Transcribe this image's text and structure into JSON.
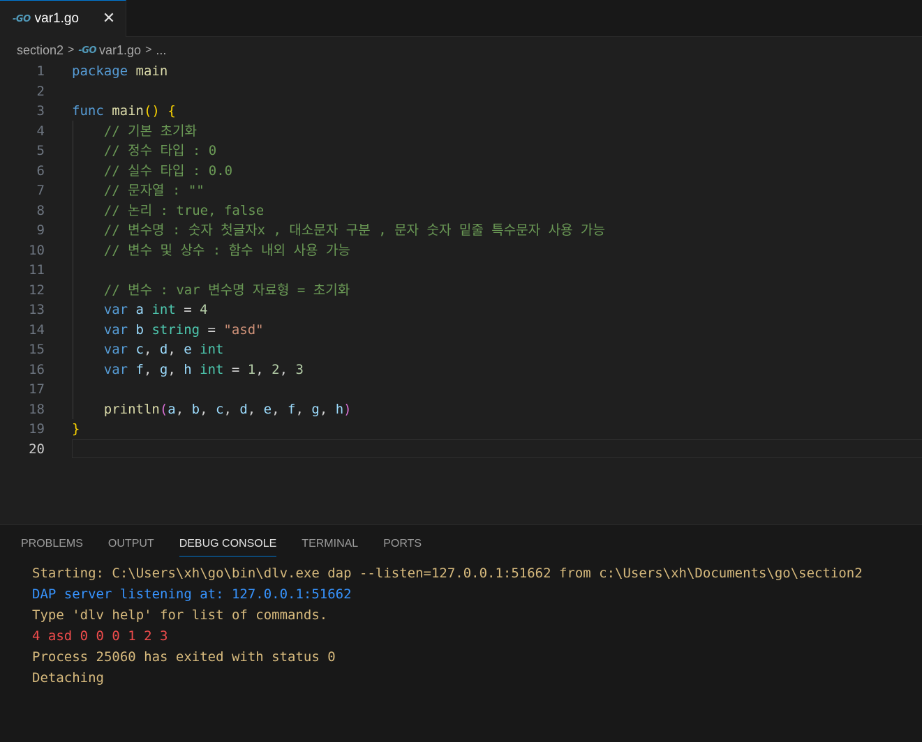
{
  "tab": {
    "icon": "go-icon",
    "label": "var1.go",
    "close": "✕"
  },
  "breadcrumb": {
    "folder": "section2",
    "file": "var1.go",
    "symbol": "..."
  },
  "editor": {
    "active_line": 20,
    "line_numbers": [
      "1",
      "2",
      "3",
      "4",
      "5",
      "6",
      "7",
      "8",
      "9",
      "10",
      "11",
      "12",
      "13",
      "14",
      "15",
      "16",
      "17",
      "18",
      "19",
      "20"
    ],
    "lines": [
      [
        [
          "kw",
          "package"
        ],
        [
          "op",
          " "
        ],
        [
          "fn",
          "main"
        ]
      ],
      [],
      [
        [
          "kw",
          "func"
        ],
        [
          "op",
          " "
        ],
        [
          "fn",
          "main"
        ],
        [
          "br1",
          "()"
        ],
        [
          "op",
          " "
        ],
        [
          "br1",
          "{"
        ]
      ],
      [
        [
          "op",
          "    "
        ],
        [
          "cm",
          "// 기본 초기화"
        ]
      ],
      [
        [
          "op",
          "    "
        ],
        [
          "cm",
          "// 정수 타입 : 0"
        ]
      ],
      [
        [
          "op",
          "    "
        ],
        [
          "cm",
          "// 실수 타입 : 0.0"
        ]
      ],
      [
        [
          "op",
          "    "
        ],
        [
          "cm",
          "// 문자열 : \"\""
        ]
      ],
      [
        [
          "op",
          "    "
        ],
        [
          "cm",
          "// 논리 : true, false"
        ]
      ],
      [
        [
          "op",
          "    "
        ],
        [
          "cm",
          "// 변수명 : 숫자 첫글자x , 대소문자 구분 , 문자 숫자 밑줄 특수문자 사용 가능"
        ]
      ],
      [
        [
          "op",
          "    "
        ],
        [
          "cm",
          "// 변수 및 상수 : 함수 내외 사용 가능"
        ]
      ],
      [],
      [
        [
          "op",
          "    "
        ],
        [
          "cm",
          "// 변수 : var 변수명 자료형 = 초기화"
        ]
      ],
      [
        [
          "op",
          "    "
        ],
        [
          "kw",
          "var"
        ],
        [
          "op",
          " "
        ],
        [
          "id",
          "a"
        ],
        [
          "op",
          " "
        ],
        [
          "ty",
          "int"
        ],
        [
          "op",
          " = "
        ],
        [
          "num",
          "4"
        ]
      ],
      [
        [
          "op",
          "    "
        ],
        [
          "kw",
          "var"
        ],
        [
          "op",
          " "
        ],
        [
          "id",
          "b"
        ],
        [
          "op",
          " "
        ],
        [
          "ty",
          "string"
        ],
        [
          "op",
          " = "
        ],
        [
          "str",
          "\"asd\""
        ]
      ],
      [
        [
          "op",
          "    "
        ],
        [
          "kw",
          "var"
        ],
        [
          "op",
          " "
        ],
        [
          "id",
          "c"
        ],
        [
          "op",
          ", "
        ],
        [
          "id",
          "d"
        ],
        [
          "op",
          ", "
        ],
        [
          "id",
          "e"
        ],
        [
          "op",
          " "
        ],
        [
          "ty",
          "int"
        ]
      ],
      [
        [
          "op",
          "    "
        ],
        [
          "kw",
          "var"
        ],
        [
          "op",
          " "
        ],
        [
          "id",
          "f"
        ],
        [
          "op",
          ", "
        ],
        [
          "id",
          "g"
        ],
        [
          "op",
          ", "
        ],
        [
          "id",
          "h"
        ],
        [
          "op",
          " "
        ],
        [
          "ty",
          "int"
        ],
        [
          "op",
          " = "
        ],
        [
          "num",
          "1"
        ],
        [
          "op",
          ", "
        ],
        [
          "num",
          "2"
        ],
        [
          "op",
          ", "
        ],
        [
          "num",
          "3"
        ]
      ],
      [],
      [
        [
          "op",
          "    "
        ],
        [
          "fn",
          "println"
        ],
        [
          "br2",
          "("
        ],
        [
          "id",
          "a"
        ],
        [
          "op",
          ", "
        ],
        [
          "id",
          "b"
        ],
        [
          "op",
          ", "
        ],
        [
          "id",
          "c"
        ],
        [
          "op",
          ", "
        ],
        [
          "id",
          "d"
        ],
        [
          "op",
          ", "
        ],
        [
          "id",
          "e"
        ],
        [
          "op",
          ", "
        ],
        [
          "id",
          "f"
        ],
        [
          "op",
          ", "
        ],
        [
          "id",
          "g"
        ],
        [
          "op",
          ", "
        ],
        [
          "id",
          "h"
        ],
        [
          "br2",
          ")"
        ]
      ],
      [
        [
          "br1",
          "}"
        ]
      ],
      []
    ]
  },
  "panel": {
    "tabs": [
      "PROBLEMS",
      "OUTPUT",
      "DEBUG CONSOLE",
      "TERMINAL",
      "PORTS"
    ],
    "active_tab": "DEBUG CONSOLE",
    "console": [
      {
        "text": "Starting: C:\\Users\\xh\\go\\bin\\dlv.exe dap --listen=127.0.0.1:51662 from c:\\Users\\xh\\Documents\\go\\section2",
        "color": "#d7ba7d"
      },
      {
        "text": "DAP server listening at: 127.0.0.1:51662",
        "color": "#3794ff"
      },
      {
        "text": "Type 'dlv help' for list of commands.",
        "color": "#d7ba7d"
      },
      {
        "text": "4 asd 0 0 0 1 2 3",
        "color": "#f14c4c"
      },
      {
        "text": "Process 25060 has exited with status 0",
        "color": "#d7ba7d"
      },
      {
        "text": "Detaching",
        "color": "#d7ba7d"
      }
    ]
  },
  "colors": {
    "background": "#1f1f1f",
    "panel_background": "#181818",
    "accent": "#0078d4"
  }
}
